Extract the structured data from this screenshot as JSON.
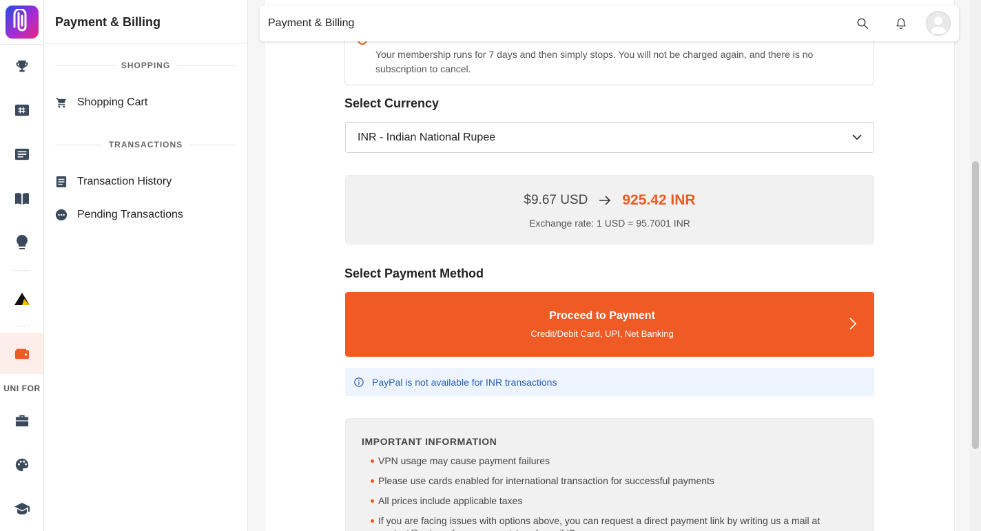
{
  "sidebar": {
    "title": "Payment & Billing",
    "sections": [
      {
        "heading": "SHOPPING",
        "items": [
          {
            "label": "Shopping Cart",
            "icon": "cart-icon"
          }
        ]
      },
      {
        "heading": "TRANSACTIONS",
        "items": [
          {
            "label": "Transaction History",
            "icon": "receipt-icon"
          },
          {
            "label": "Pending Transactions",
            "icon": "more-circle-icon"
          }
        ]
      }
    ]
  },
  "rail": {
    "label": "UNI FOR",
    "icons": [
      "trophy-icon",
      "hashtag-card-icon",
      "news-icon",
      "book-icon",
      "lightbulb-icon",
      "triangle-logo-icon",
      "wallet-icon",
      "briefcase-icon",
      "palette-icon",
      "graduation-cap-icon"
    ],
    "active": "wallet-icon"
  },
  "topbar": {
    "title": "Payment & Billing"
  },
  "notice": {
    "text": "Your membership runs for 7 days and then simply stops. You will not be charged again, and there is no subscription to cancel."
  },
  "currency": {
    "heading": "Select Currency",
    "selected": "INR - Indian National Rupee",
    "from_amount": "$9.67 USD",
    "to_amount": "925.42 INR",
    "rate": "Exchange rate: 1 USD = 95.7001 INR"
  },
  "payment": {
    "heading": "Select Payment Method",
    "button_title": "Proceed to Payment",
    "button_subtitle": "Credit/Debit Card, UPI, Net Banking",
    "info": "PayPal is not available for INR transactions"
  },
  "important": {
    "heading": "IMPORTANT INFORMATION",
    "items": [
      "VPN usage may cause payment failures",
      "Please use cards enabled for international transaction for successful payments",
      "All prices include applicable taxes",
      "If you are facing issues with options above, you can request a direct payment link by writing us a mail at contact@uni.xyz from your registered email ID"
    ]
  },
  "colors": {
    "accent": "#f05a24",
    "info_text": "#2b5fb0",
    "info_bg": "#eef4fd"
  }
}
